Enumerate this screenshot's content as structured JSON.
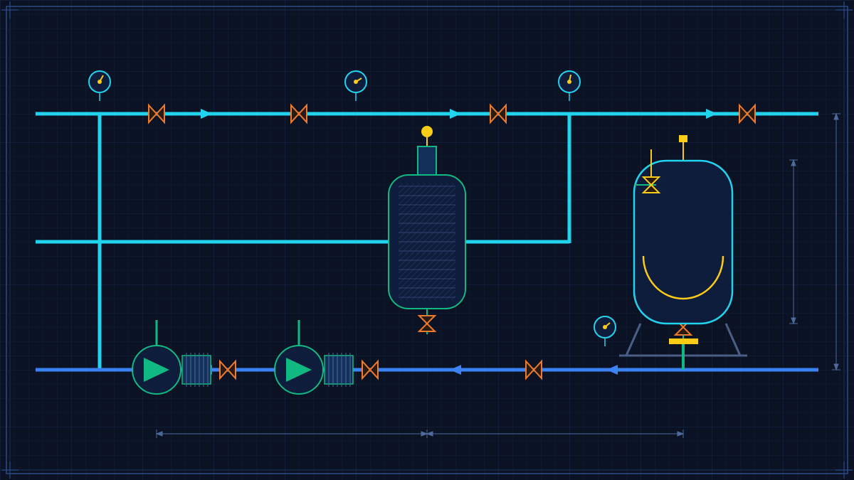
{
  "colors": {
    "background": "#0b1224",
    "grid": "#16233d",
    "grid_major": "#1d2f52",
    "frame": "#2a4a86",
    "supply_line": "#22d3ee",
    "return_line": "#3b82f6",
    "valve": "#f07a2b",
    "gauge_ring": "#22d3ee",
    "gauge_needle": "#facc15",
    "equipment_fill": "#0f1d3d",
    "heat_exchanger_stroke": "#10b981",
    "pump_stroke": "#10b981",
    "pump_impeller": "#10b981",
    "tank_stroke": "#22d3ee",
    "tank_coil": "#facc15",
    "tank_support": "#4b5f86",
    "dimension_line": "#4b6a9b"
  },
  "icons": [
    "pressure-gauge-icon",
    "gate-valve-icon",
    "flow-arrow-icon",
    "pump-icon",
    "motor-icon",
    "relief-valve-icon"
  ],
  "diagram": {
    "supply_header_flow": "right",
    "return_header_flow": "left",
    "equipment": [
      "heat-exchanger",
      "pump",
      "pump",
      "storage-tank"
    ]
  }
}
